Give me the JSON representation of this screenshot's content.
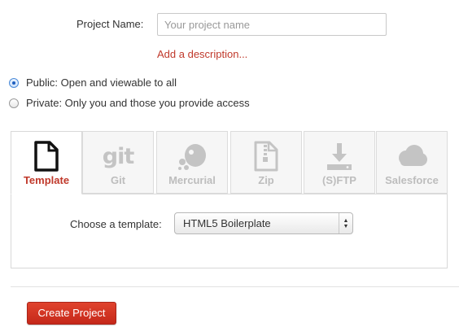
{
  "form": {
    "project_name_label": "Project Name:",
    "project_name_placeholder": "Your project name",
    "project_name_value": "",
    "add_description": "Add a description..."
  },
  "visibility": {
    "selected": "public",
    "options": [
      {
        "id": "public",
        "label": "Public: Open and viewable to all"
      },
      {
        "id": "private",
        "label": "Private: Only you and those you provide access"
      }
    ]
  },
  "source_tabs": {
    "selected": "template",
    "items": [
      {
        "id": "template",
        "label": "Template",
        "icon": "document-icon"
      },
      {
        "id": "git",
        "label": "Git",
        "icon": "git-icon",
        "icon_text": "git"
      },
      {
        "id": "mercurial",
        "label": "Mercurial",
        "icon": "mercurial-icon"
      },
      {
        "id": "zip",
        "label": "Zip",
        "icon": "zip-file-icon"
      },
      {
        "id": "sftp",
        "label": "(S)FTP",
        "icon": "download-to-server-icon"
      },
      {
        "id": "salesforce",
        "label": "Salesforce",
        "icon": "cloud-icon"
      }
    ]
  },
  "template_panel": {
    "choose_label": "Choose a template:",
    "selected_template": "HTML5 Boilerplate"
  },
  "actions": {
    "create_label": "Create Project"
  },
  "colors": {
    "accent": "#c0392b",
    "button": "#d2311f",
    "tab_inactive": "#f6f6f6",
    "icon_inactive": "#c4c4c4"
  }
}
